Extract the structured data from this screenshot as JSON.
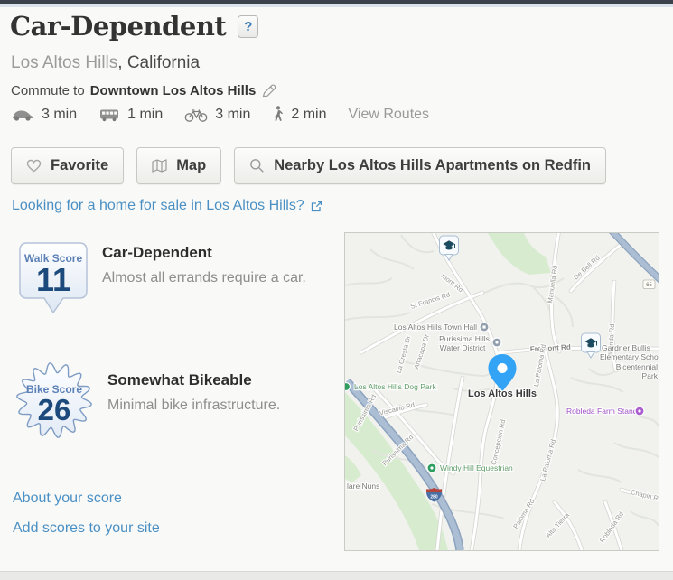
{
  "header": {
    "title": "Car-Dependent",
    "help": "?",
    "city": "Los Altos Hills",
    "state_suffix": ", California",
    "commute_prefix": "Commute to",
    "commute_destination": "Downtown Los Altos Hills"
  },
  "transit": {
    "drive_time": "3 min",
    "bus_time": "1 min",
    "bike_time": "3 min",
    "walk_time": "2 min",
    "view_routes": "View Routes"
  },
  "actions": {
    "favorite": "Favorite",
    "map": "Map",
    "nearby": "Nearby Los Altos Hills Apartments on Redfin"
  },
  "redfin_link": "Looking for a home for sale in Los Altos Hills?",
  "scores": {
    "walk": {
      "badge_label": "Walk Score",
      "value": "11",
      "heading": "Car-Dependent",
      "description": "Almost all errands require a car."
    },
    "bike": {
      "badge_label": "Bike Score",
      "value": "26",
      "heading": "Somewhat Bikeable",
      "description": "Minimal bike infrastructure."
    }
  },
  "footer_links": {
    "about": "About your score",
    "embed": "Add scores to your site"
  },
  "map": {
    "pin_label": "Los Altos Hills",
    "shields": {
      "interstate": "280",
      "route": "65"
    },
    "labels": [
      {
        "text": "mont Rd"
      },
      {
        "text": "St Francis Rd"
      },
      {
        "text": "Los Altos Hills Town Hall"
      },
      {
        "text": "Purissima Hills"
      },
      {
        "text": "Water District"
      },
      {
        "text": "Fremont Rd"
      },
      {
        "text": "Manuella Rd"
      },
      {
        "text": "De Bell Rd"
      },
      {
        "text": "Miranda Rd"
      },
      {
        "text": "Gardner Bullis"
      },
      {
        "text": "Elementary School"
      },
      {
        "text": "Bicentennial"
      },
      {
        "text": "Park"
      },
      {
        "text": "Los Altos Hills Dog Park"
      },
      {
        "text": "La Cresta Dr"
      },
      {
        "text": "Anacapa Dr"
      },
      {
        "text": "La Paloma Rd"
      },
      {
        "text": "Robleda Farm Stand"
      },
      {
        "text": "Purissima Rd"
      },
      {
        "text": "Viscaino Rd"
      },
      {
        "text": "Purissima Rd"
      },
      {
        "text": "Windy Hill Equestrian"
      },
      {
        "text": "lare Nuns"
      },
      {
        "text": "Concepcion Rd"
      },
      {
        "text": "La Paloma Rd"
      },
      {
        "text": "Chapin Rd"
      },
      {
        "text": "Robleda Rd"
      },
      {
        "text": "Paloma Rd"
      },
      {
        "text": "Alta Tierra"
      }
    ]
  },
  "colors": {
    "link_blue": "#4b90c4",
    "score_navy": "#1c4a7c",
    "badge_label_blue": "#5b80b6",
    "pin_blue": "#33a3f5",
    "poi_green": "#5f9c68",
    "poi_purple": "#a052c4",
    "map_green_area": "#d7eccf",
    "highway_blue_gray": "#abbed4"
  }
}
